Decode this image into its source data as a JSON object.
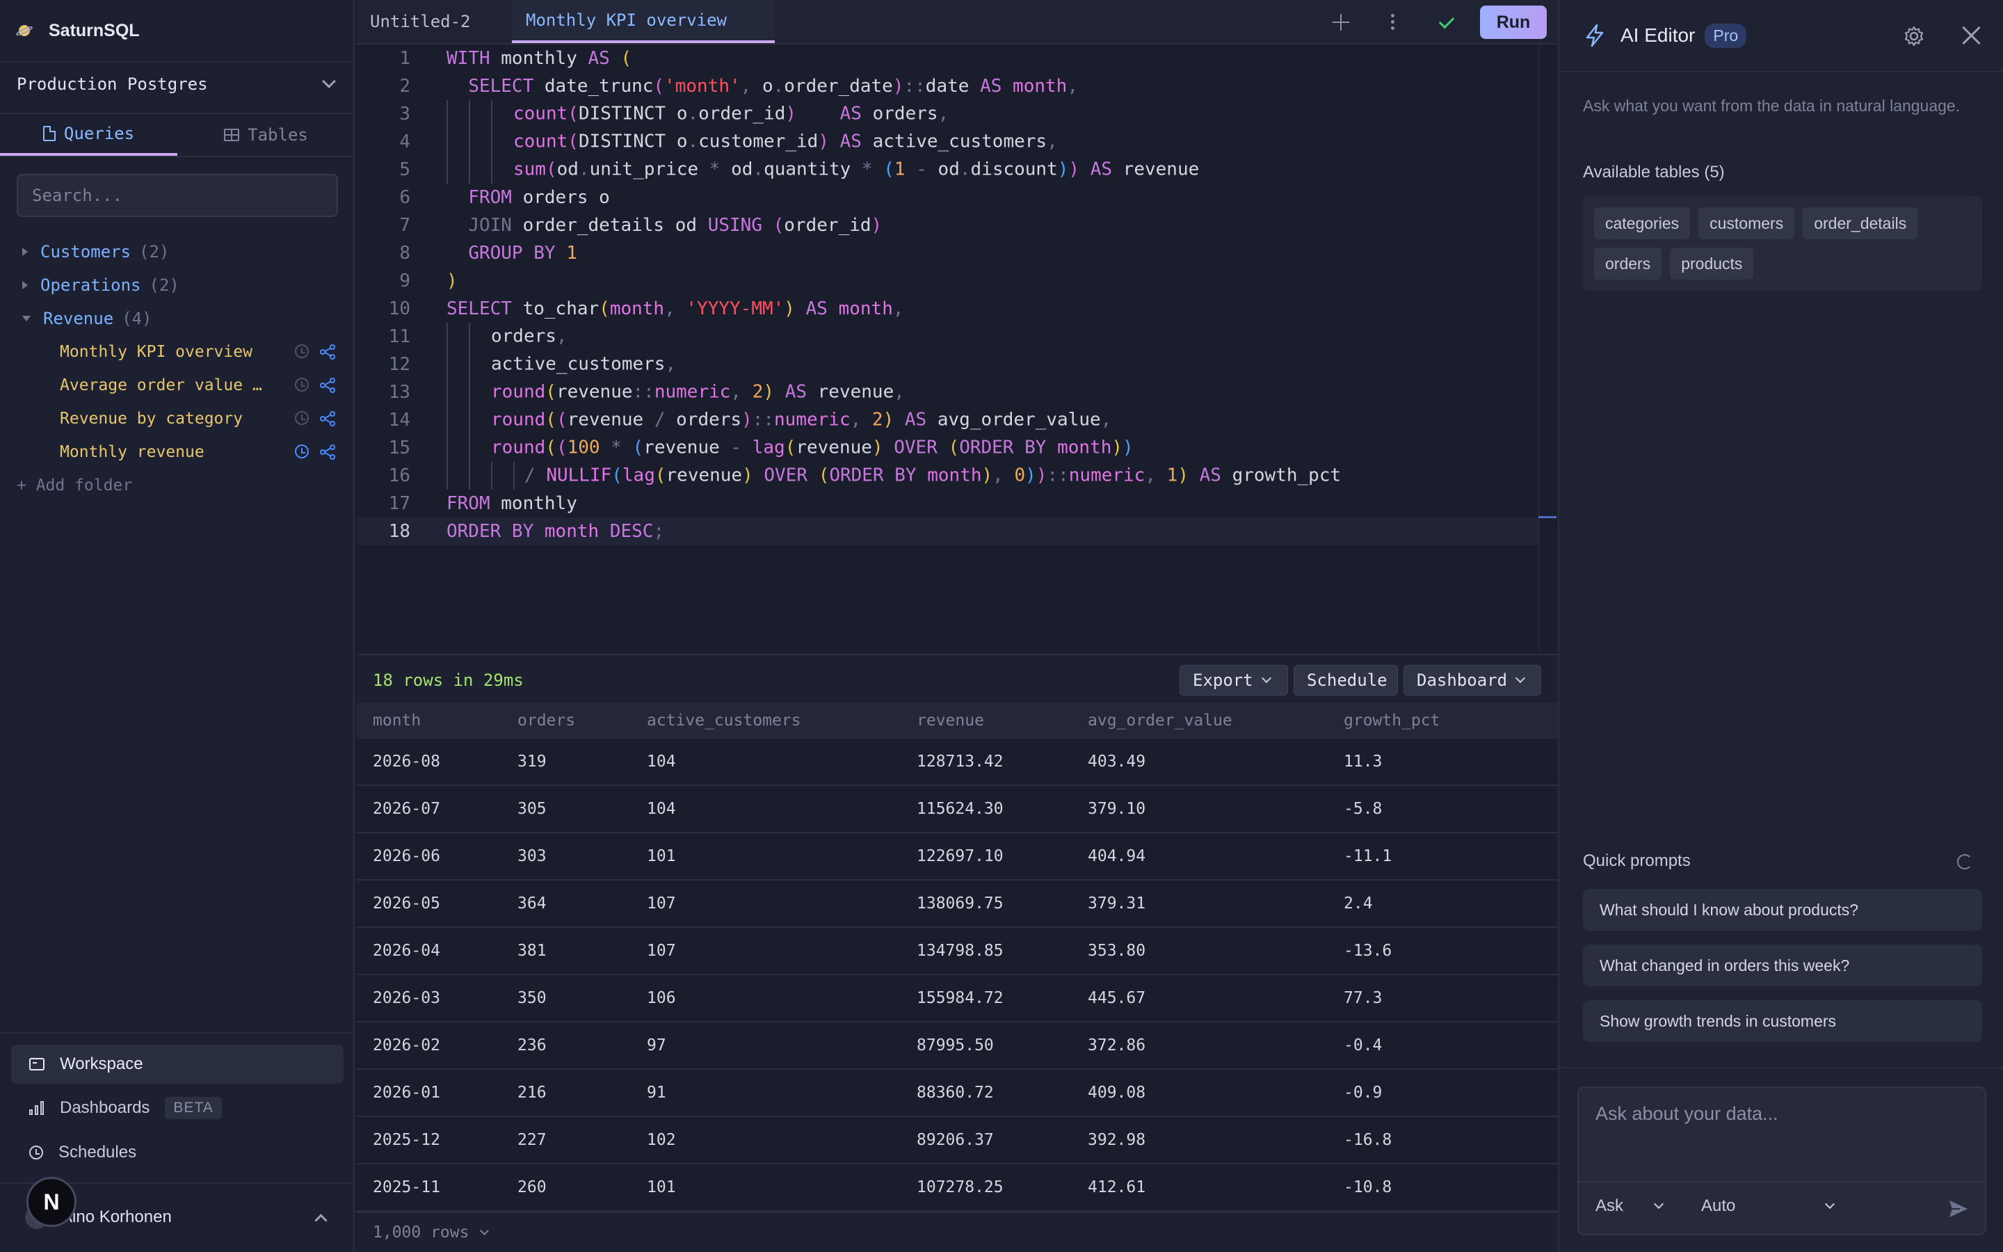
{
  "app": {
    "name": "SaturnSQL"
  },
  "sidebar": {
    "connection": "Production Postgres",
    "tabs": [
      {
        "label": "Queries",
        "active": true
      },
      {
        "label": "Tables",
        "active": false
      }
    ],
    "search_placeholder": "Search...",
    "folders": [
      {
        "name": "Customers",
        "count": "(2)",
        "open": false
      },
      {
        "name": "Operations",
        "count": "(2)",
        "open": false
      },
      {
        "name": "Revenue",
        "count": "(4)",
        "open": true,
        "items": [
          {
            "name": "Monthly KPI overview",
            "scheduled": false
          },
          {
            "name": "Average order value …",
            "scheduled": false
          },
          {
            "name": "Revenue by category",
            "scheduled": false
          },
          {
            "name": "Monthly revenue",
            "scheduled": true
          }
        ]
      }
    ],
    "add_folder": "+ Add folder",
    "nav": [
      {
        "label": "Workspace",
        "icon": "workspace-icon",
        "active": true
      },
      {
        "label": "Dashboards",
        "icon": "bar-chart-icon",
        "badge": "BETA"
      },
      {
        "label": "Schedules",
        "icon": "clock-icon"
      }
    ],
    "user": {
      "name": "Aino Korhonen",
      "badge": "N"
    }
  },
  "editor": {
    "tabs": [
      {
        "label": "Untitled-2",
        "active": false
      },
      {
        "label": "Monthly KPI overview",
        "active": true
      }
    ],
    "run_label": "Run",
    "current_line": 18
  },
  "results": {
    "summary": "18 rows in 29ms",
    "buttons": {
      "export": "Export",
      "schedule": "Schedule",
      "dashboard": "Dashboard"
    },
    "columns": [
      "month",
      "orders",
      "active_customers",
      "revenue",
      "avg_order_value",
      "growth_pct"
    ],
    "rows": [
      [
        "2026-08",
        "319",
        "104",
        "128713.42",
        "403.49",
        "11.3"
      ],
      [
        "2026-07",
        "305",
        "104",
        "115624.30",
        "379.10",
        "-5.8"
      ],
      [
        "2026-06",
        "303",
        "101",
        "122697.10",
        "404.94",
        "-11.1"
      ],
      [
        "2026-05",
        "364",
        "107",
        "138069.75",
        "379.31",
        "2.4"
      ],
      [
        "2026-04",
        "381",
        "107",
        "134798.85",
        "353.80",
        "-13.6"
      ],
      [
        "2026-03",
        "350",
        "106",
        "155984.72",
        "445.67",
        "77.3"
      ],
      [
        "2026-02",
        "236",
        "97",
        "87995.50",
        "372.86",
        "-0.4"
      ],
      [
        "2026-01",
        "216",
        "91",
        "88360.72",
        "409.08",
        "-0.9"
      ],
      [
        "2025-12",
        "227",
        "102",
        "89206.37",
        "392.98",
        "-16.8"
      ],
      [
        "2025-11",
        "260",
        "101",
        "107278.25",
        "412.61",
        "-10.8"
      ]
    ],
    "row_limit": "1,000 rows"
  },
  "ai_panel": {
    "title": "AI Editor",
    "plan_badge": "Pro",
    "description": "Ask what you want from the data in natural language.",
    "tables_title": "Available tables (5)",
    "tables": [
      "categories",
      "customers",
      "order_details",
      "orders",
      "products"
    ],
    "quick_prompts_title": "Quick prompts",
    "quick_prompts": [
      "What should I know about products?",
      "What changed in orders this week?",
      "Show growth trends in customers"
    ],
    "input_placeholder": "Ask about your data...",
    "mode": "Ask",
    "model": "Auto"
  },
  "colors": {
    "accent": "#8cb8ff",
    "run_gradient_start": "#9fb0ff",
    "run_gradient_end": "#b69ef2",
    "query_item": "#e8c66a",
    "success": "#a6e36a"
  }
}
